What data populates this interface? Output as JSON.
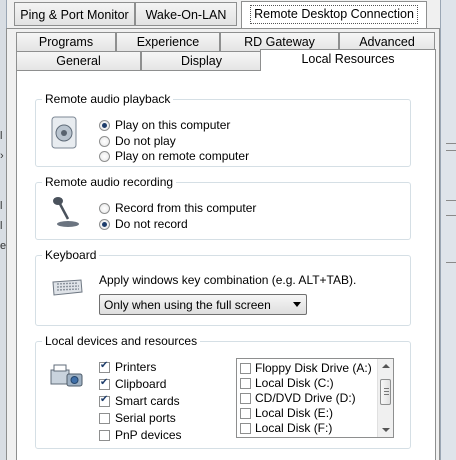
{
  "outer_tabs": [
    {
      "label": "Ping & Port Monitor"
    },
    {
      "label": "Wake-On-LAN"
    },
    {
      "label": "Remote Desktop Connection"
    }
  ],
  "inner_tabs_row1": [
    {
      "label": "Programs"
    },
    {
      "label": "Experience"
    },
    {
      "label": "RD Gateway"
    },
    {
      "label": "Advanced"
    }
  ],
  "inner_tabs_row2": [
    {
      "label": "General"
    },
    {
      "label": "Display"
    },
    {
      "label": "Local Resources"
    }
  ],
  "audio_playback": {
    "title": "Remote audio playback",
    "options": [
      {
        "label": "Play on this computer",
        "selected": true
      },
      {
        "label": "Do not play",
        "selected": false
      },
      {
        "label": "Play on remote computer",
        "selected": false
      }
    ]
  },
  "audio_recording": {
    "title": "Remote audio recording",
    "options": [
      {
        "label": "Record from this computer",
        "selected": false
      },
      {
        "label": "Do not record",
        "selected": true
      }
    ]
  },
  "keyboard": {
    "title": "Keyboard",
    "description": "Apply windows key combination (e.g. ALT+TAB).",
    "selected": "Only when using the full screen"
  },
  "devices": {
    "title": "Local devices and resources",
    "checkboxes": [
      {
        "label": "Printers",
        "checked": true
      },
      {
        "label": "Clipboard",
        "checked": true
      },
      {
        "label": "Smart cards",
        "checked": true
      },
      {
        "label": "Serial ports",
        "checked": false
      },
      {
        "label": "PnP devices",
        "checked": false
      }
    ],
    "drives": [
      {
        "label": "Floppy Disk Drive (A:)",
        "checked": false
      },
      {
        "label": "Local Disk (C:)",
        "checked": false
      },
      {
        "label": "CD/DVD Drive (D:)",
        "checked": false
      },
      {
        "label": "Local Disk (E:)",
        "checked": false
      },
      {
        "label": "Local Disk (F:)",
        "checked": false
      }
    ]
  },
  "colors": {
    "accent": "#1e3d6b",
    "group_border": "#d5dfe5"
  }
}
